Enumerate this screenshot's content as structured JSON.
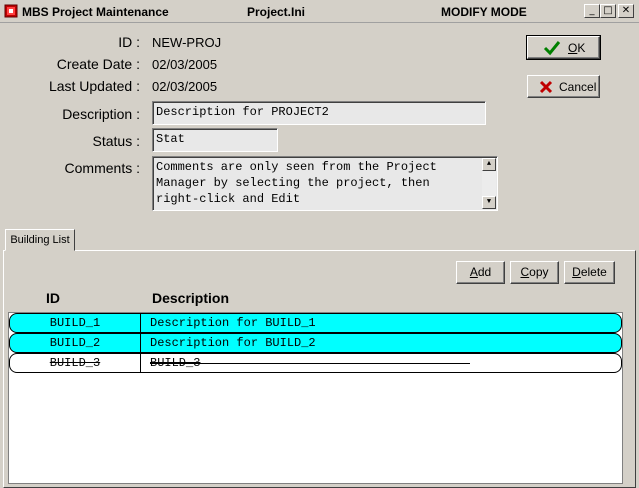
{
  "titlebar": {
    "app_title": "MBS Project Maintenance",
    "file": "Project.Ini",
    "mode": "MODIFY MODE",
    "minimize": "_",
    "maximize": "□",
    "close": "✕"
  },
  "form": {
    "id_label": "ID :",
    "id_value": "NEW-PROJ",
    "create_label": "Create Date :",
    "create_value": "02/03/2005",
    "updated_label": "Last Updated :",
    "updated_value": "02/03/2005",
    "description_label": "Description :",
    "description_value": "Description for PROJECT2",
    "status_label": "Status :",
    "status_value": "Stat",
    "comments_label": "Comments :",
    "comments_lines": [
      "Comments are only seen from the Project",
      "Manager by selecting the project, then",
      "right-click and Edit"
    ]
  },
  "buttons": {
    "ok": "OK",
    "ok_mnemonic": "O",
    "ok_rest": "K",
    "cancel": "Cancel",
    "add": "Add",
    "add_mnemonic": "A",
    "add_rest": "dd",
    "copy": "Copy",
    "copy_mnemonic": "C",
    "copy_rest": "opy",
    "delete": "Delete",
    "delete_mnemonic": "D",
    "delete_rest": "elete"
  },
  "tabs": {
    "building_list": "Building List"
  },
  "buildings": {
    "columns": {
      "id": "ID",
      "description": "Description"
    },
    "rows": [
      {
        "id": "BUILD_1",
        "description": "Description for BUILD_1",
        "state": "selected"
      },
      {
        "id": "BUILD_2",
        "description": "Description for BUILD_2",
        "state": "selected"
      },
      {
        "id": "BUILD_3",
        "description": "BUILD_3",
        "state": "deleted"
      }
    ]
  },
  "colors": {
    "selection": "#00ffff",
    "ok_check": "#008000",
    "cancel_x": "#c00000"
  },
  "icons": {
    "app": "app-icon",
    "ok": "checkmark-icon",
    "cancel": "x-icon"
  }
}
